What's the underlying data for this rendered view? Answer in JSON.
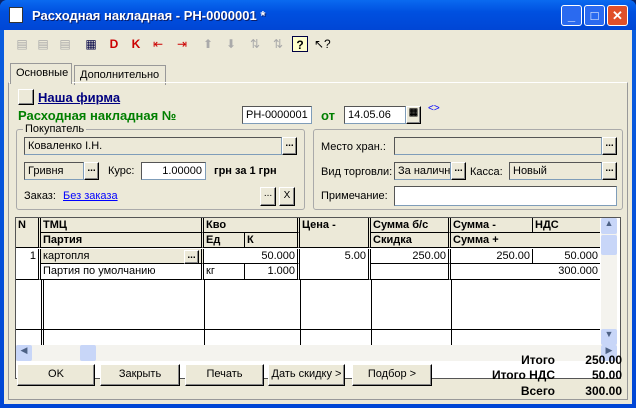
{
  "window": {
    "title": "Расходная накладная - РН-0000001 *",
    "min": "_",
    "max": "□",
    "close": "✕"
  },
  "toolbar": [
    "new",
    "copy",
    "delete",
    "save",
    "dt",
    "dk",
    "move-left",
    "move-right",
    "up",
    "down",
    "sort-asc",
    "sort-desc",
    "help",
    "whats-this"
  ],
  "tabs": [
    "Основные",
    "Дополнительно"
  ],
  "header": {
    "firm_link": "Наша фирма",
    "doc_label": "Расходная накладная №",
    "doc_number": "РН-0000001",
    "date_label": "от",
    "date": "14.05.06",
    "arrows": "<>"
  },
  "buyer": {
    "group_label": "Покупатель",
    "buyer": "Коваленко І.Н.",
    "currency": "Гривня",
    "rate_label": "Курс:",
    "rate": "1.00000",
    "rate_text": "грн за 1 грн",
    "order_label": "Заказ:",
    "order_link": "Без заказа",
    "ellipsis": "...",
    "clear": "X"
  },
  "right": {
    "storage_label": "Место хран.:",
    "storage": "",
    "trade_label": "Вид торговли:",
    "trade": "За наличн",
    "cash_label": "Касса:",
    "cash": "Новый",
    "note_label": "Примечание:",
    "note": ""
  },
  "table": {
    "headers": {
      "n": "N",
      "tmc": "ТМЦ",
      "party": "Партия",
      "qty": "Кво",
      "unit": "Ед",
      "k": "К",
      "price": "Цена -",
      "sum_bs": "Сумма б/с",
      "discount": "Скидка",
      "sum": "Сумма -",
      "vat": "НДС",
      "sum_plus": "Сумма +"
    },
    "rows": [
      {
        "n": "1",
        "tmc": "картопля",
        "party": "Партия по умолчанию",
        "qty": "50.000",
        "unit": "кг",
        "k": "1.000",
        "price": "5.00",
        "sum_bs": "250.00",
        "discount": "",
        "sum": "250.00",
        "vat": "50.000",
        "sum_plus": "300.000"
      }
    ]
  },
  "buttons": {
    "ok": "OK",
    "close": "Закрыть",
    "print": "Печать",
    "discount": "Дать скидку >",
    "select": "Подбор >"
  },
  "totals": {
    "total_label": "Итого",
    "total": "250.00",
    "vat_label": "Итого НДС",
    "vat": "50.00",
    "all_label": "Всего",
    "all": "300.00"
  }
}
